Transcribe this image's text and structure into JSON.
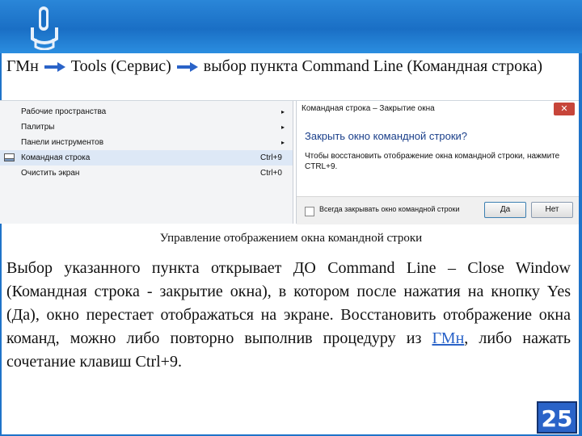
{
  "colors": {
    "banner": "#1f73c9",
    "link": "#2a63c8",
    "page_badge": "#2a63c8"
  },
  "headline": {
    "part1": "ГМн",
    "part2": "Tools (Сервис)",
    "part3": "выбор пункта Command Line (Командная строка)"
  },
  "menu": {
    "items": [
      {
        "label": "Рабочие пространства",
        "shortcut": "",
        "submenu": "▸"
      },
      {
        "label": "Палитры",
        "shortcut": "",
        "submenu": "▸"
      },
      {
        "label": "Панели инструментов",
        "shortcut": "",
        "submenu": "▸"
      },
      {
        "label": "Командная строка",
        "shortcut": "Ctrl+9",
        "submenu": ""
      },
      {
        "label": "Очистить экран",
        "shortcut": "Ctrl+0",
        "submenu": ""
      }
    ]
  },
  "dialog": {
    "title": "Командная строка – Закрытие окна",
    "close_glyph": "✕",
    "question": "Закрыть окно командной строки?",
    "info": "Чтобы восстановить отображение окна командной строки, нажмите CTRL+9.",
    "checkbox_label": "Всегда закрывать окно командной строки",
    "yes_label": "Да",
    "no_label": "Нет"
  },
  "caption": "Управление отображением окна командной строки",
  "paragraph": {
    "before_link": "Выбор указанного пункта открывает ДО Command Line – Close Window (Командная строка - закрытие окна), в котором после нажатия на кнопку Yes (Да), окно перестает отображаться на экране. Восстановить отображение окна команд, можно либо повторно выполнив процедуру из ",
    "link": "ГМн",
    "after_link": ", либо нажать сочетание клавиш Ctrl+9."
  },
  "page_number": "25"
}
